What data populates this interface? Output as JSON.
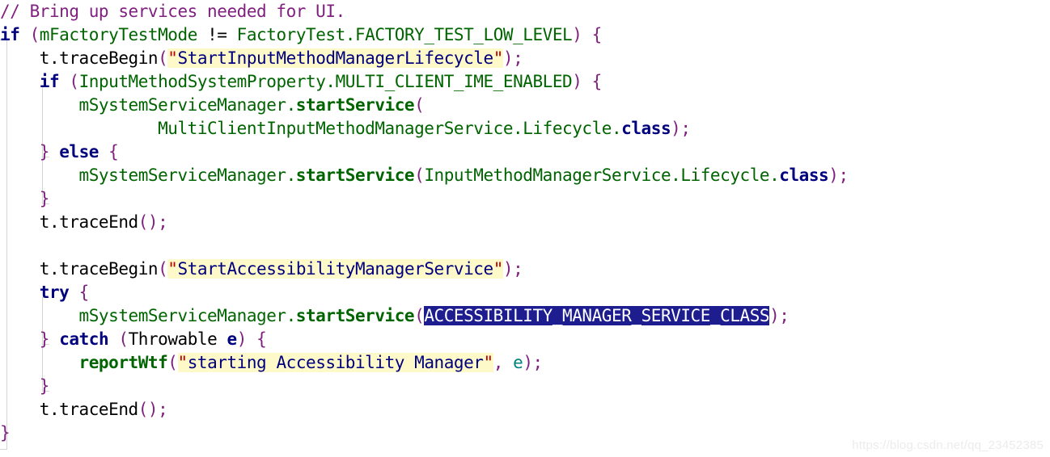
{
  "editor": {
    "language": "java",
    "background_color": "#ffffff",
    "selection_color": "#1d1d8f",
    "string_highlight_color": "#fdf9c8",
    "comment_color": "#7f1f7f",
    "keyword_color": "#00007f",
    "identifier_color": "#006400",
    "punctuation_color": "#7f1f7f"
  },
  "watermark": {
    "text": "https://blog.csdn.net/qq_23452385"
  },
  "code": {
    "lines": [
      {
        "index": 1,
        "indent": 0,
        "text": "// Bring up services needed for UI.",
        "tokens": [
          {
            "t": "// Bring up services needed for UI.",
            "c": "tok-comment"
          }
        ]
      },
      {
        "index": 2,
        "indent": 0,
        "text": "if (mFactoryTestMode != FactoryTest.FACTORY_TEST_LOW_LEVEL) {",
        "tokens": [
          {
            "t": "if",
            "c": "tok-keyword"
          },
          {
            "t": " ",
            "c": "tok-plain"
          },
          {
            "t": "(",
            "c": "tok-punct"
          },
          {
            "t": "mFactoryTestMode",
            "c": "tok-ident"
          },
          {
            "t": " != ",
            "c": "tok-plain"
          },
          {
            "t": "FactoryTest.FACTORY_TEST_LOW_LEVEL",
            "c": "tok-ident"
          },
          {
            "t": ")",
            "c": "tok-punct"
          },
          {
            "t": " ",
            "c": "tok-plain"
          },
          {
            "t": "{",
            "c": "tok-punct"
          }
        ]
      },
      {
        "index": 3,
        "indent": 4,
        "text": "    t.traceBegin(\"StartInputMethodManagerLifecycle\");",
        "tokens": [
          {
            "t": "    t.traceBegin",
            "c": "tok-plain"
          },
          {
            "t": "(",
            "c": "tok-punct"
          },
          {
            "t": "\"",
            "c": "tok-quote hl-string"
          },
          {
            "t": "StartInputMethodManagerLifecycle",
            "c": "tok-string hl-string"
          },
          {
            "t": "\"",
            "c": "tok-quote hl-string"
          },
          {
            "t": ");",
            "c": "tok-punct"
          }
        ]
      },
      {
        "index": 4,
        "indent": 4,
        "text": "    if (InputMethodSystemProperty.MULTI_CLIENT_IME_ENABLED) {",
        "tokens": [
          {
            "t": "    ",
            "c": "tok-plain"
          },
          {
            "t": "if",
            "c": "tok-keyword"
          },
          {
            "t": " ",
            "c": "tok-plain"
          },
          {
            "t": "(",
            "c": "tok-punct"
          },
          {
            "t": "InputMethodSystemProperty.MULTI_CLIENT_IME_ENABLED",
            "c": "tok-ident"
          },
          {
            "t": ")",
            "c": "tok-punct"
          },
          {
            "t": " ",
            "c": "tok-plain"
          },
          {
            "t": "{",
            "c": "tok-punct"
          }
        ]
      },
      {
        "index": 5,
        "indent": 8,
        "text": "        mSystemServiceManager.startService(",
        "tokens": [
          {
            "t": "        ",
            "c": "tok-plain"
          },
          {
            "t": "mSystemServiceManager.",
            "c": "tok-ident"
          },
          {
            "t": "startService",
            "c": "tok-method"
          },
          {
            "t": "(",
            "c": "tok-punct"
          }
        ]
      },
      {
        "index": 6,
        "indent": 16,
        "text": "                MultiClientInputMethodManagerService.Lifecycle.class);",
        "tokens": [
          {
            "t": "                ",
            "c": "tok-plain"
          },
          {
            "t": "MultiClientInputMethodManagerService.Lifecycle.",
            "c": "tok-ident"
          },
          {
            "t": "class",
            "c": "tok-keyword"
          },
          {
            "t": ");",
            "c": "tok-punct"
          }
        ]
      },
      {
        "index": 7,
        "indent": 4,
        "text": "    } else {",
        "tokens": [
          {
            "t": "    ",
            "c": "tok-plain"
          },
          {
            "t": "}",
            "c": "tok-punct"
          },
          {
            "t": " ",
            "c": "tok-plain"
          },
          {
            "t": "else",
            "c": "tok-keyword"
          },
          {
            "t": " ",
            "c": "tok-plain"
          },
          {
            "t": "{",
            "c": "tok-punct"
          }
        ]
      },
      {
        "index": 8,
        "indent": 8,
        "text": "        mSystemServiceManager.startService(InputMethodManagerService.Lifecycle.class);",
        "tokens": [
          {
            "t": "        ",
            "c": "tok-plain"
          },
          {
            "t": "mSystemServiceManager.",
            "c": "tok-ident"
          },
          {
            "t": "startService",
            "c": "tok-method"
          },
          {
            "t": "(",
            "c": "tok-punct"
          },
          {
            "t": "InputMethodManagerService.Lifecycle.",
            "c": "tok-ident"
          },
          {
            "t": "class",
            "c": "tok-keyword"
          },
          {
            "t": ");",
            "c": "tok-punct"
          }
        ]
      },
      {
        "index": 9,
        "indent": 4,
        "text": "    }",
        "tokens": [
          {
            "t": "    ",
            "c": "tok-plain"
          },
          {
            "t": "}",
            "c": "tok-punct"
          }
        ]
      },
      {
        "index": 10,
        "indent": 4,
        "text": "    t.traceEnd();",
        "tokens": [
          {
            "t": "    t.traceEnd",
            "c": "tok-plain"
          },
          {
            "t": "();",
            "c": "tok-punct"
          }
        ]
      },
      {
        "index": 11,
        "indent": 0,
        "text": "",
        "tokens": []
      },
      {
        "index": 12,
        "indent": 4,
        "text": "    t.traceBegin(\"StartAccessibilityManagerService\");",
        "tokens": [
          {
            "t": "    t.traceBegin",
            "c": "tok-plain"
          },
          {
            "t": "(",
            "c": "tok-punct"
          },
          {
            "t": "\"",
            "c": "tok-quote hl-string"
          },
          {
            "t": "StartAccessibilityManagerService",
            "c": "tok-string hl-string"
          },
          {
            "t": "\"",
            "c": "tok-quote hl-string"
          },
          {
            "t": ");",
            "c": "tok-punct"
          }
        ]
      },
      {
        "index": 13,
        "indent": 4,
        "text": "    try {",
        "tokens": [
          {
            "t": "    ",
            "c": "tok-plain"
          },
          {
            "t": "try",
            "c": "tok-keyword"
          },
          {
            "t": " ",
            "c": "tok-plain"
          },
          {
            "t": "{",
            "c": "tok-punct"
          }
        ]
      },
      {
        "index": 14,
        "indent": 8,
        "text": "        mSystemServiceManager.startService(ACCESSIBILITY_MANAGER_SERVICE_CLASS);",
        "tokens": [
          {
            "t": "        ",
            "c": "tok-plain"
          },
          {
            "t": "mSystemServiceManager.",
            "c": "tok-ident"
          },
          {
            "t": "startService",
            "c": "tok-method"
          },
          {
            "t": "(",
            "c": "tok-punct"
          },
          {
            "t": "ACCESSIBILITY_MANAGER_SERVICE_CLASS",
            "c": "hl-select"
          },
          {
            "t": ");",
            "c": "tok-punct"
          }
        ]
      },
      {
        "index": 15,
        "indent": 4,
        "text": "    } catch (Throwable e) {",
        "tokens": [
          {
            "t": "    ",
            "c": "tok-plain"
          },
          {
            "t": "}",
            "c": "tok-punct"
          },
          {
            "t": " ",
            "c": "tok-plain"
          },
          {
            "t": "catch",
            "c": "tok-keyword"
          },
          {
            "t": " ",
            "c": "tok-plain"
          },
          {
            "t": "(",
            "c": "tok-punct"
          },
          {
            "t": "Throwable",
            "c": "tok-plain"
          },
          {
            "t": " ",
            "c": "tok-plain"
          },
          {
            "t": "e",
            "c": "tok-field"
          },
          {
            "t": ")",
            "c": "tok-punct"
          },
          {
            "t": " ",
            "c": "tok-plain"
          },
          {
            "t": "{",
            "c": "tok-punct"
          }
        ]
      },
      {
        "index": 16,
        "indent": 8,
        "text": "        reportWtf(\"starting Accessibility Manager\", e);",
        "tokens": [
          {
            "t": "        ",
            "c": "tok-plain"
          },
          {
            "t": "reportWtf",
            "c": "tok-method"
          },
          {
            "t": "(",
            "c": "tok-punct"
          },
          {
            "t": "\"",
            "c": "tok-quote hl-string"
          },
          {
            "t": "starting Accessibility Manager",
            "c": "tok-string hl-string"
          },
          {
            "t": "\"",
            "c": "tok-quote hl-string"
          },
          {
            "t": ",",
            "c": "tok-punct"
          },
          {
            "t": " ",
            "c": "tok-plain"
          },
          {
            "t": "e",
            "c": "tok-local"
          },
          {
            "t": ");",
            "c": "tok-punct"
          }
        ]
      },
      {
        "index": 17,
        "indent": 4,
        "text": "    }",
        "tokens": [
          {
            "t": "    ",
            "c": "tok-plain"
          },
          {
            "t": "}",
            "c": "tok-punct"
          }
        ]
      },
      {
        "index": 18,
        "indent": 4,
        "text": "    t.traceEnd();",
        "tokens": [
          {
            "t": "    t.traceEnd",
            "c": "tok-plain"
          },
          {
            "t": "();",
            "c": "tok-punct"
          }
        ]
      },
      {
        "index": 19,
        "indent": 0,
        "text": "}",
        "tokens": [
          {
            "t": "}",
            "c": "tok-punct"
          }
        ]
      }
    ]
  }
}
